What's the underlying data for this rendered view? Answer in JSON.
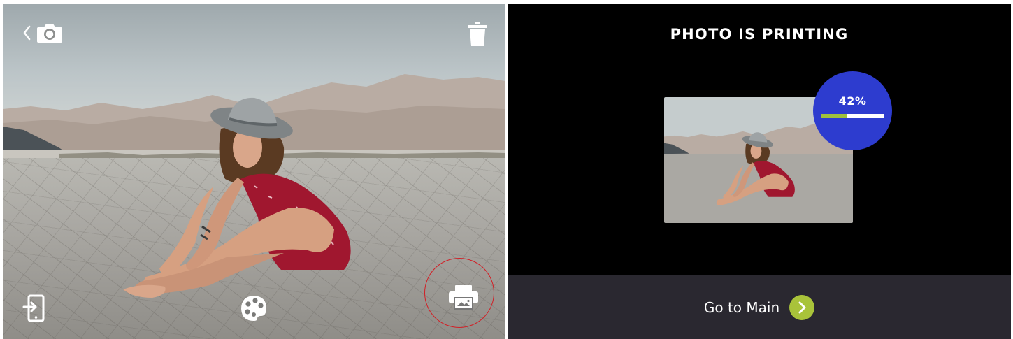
{
  "preview": {
    "icons": {
      "back": "chevron-left-icon",
      "camera": "camera-icon",
      "delete": "trash-icon",
      "share": "share-to-device-icon",
      "edit": "palette-icon",
      "print": "printer-icon"
    },
    "highlight_color": "#d21f26"
  },
  "printing": {
    "title": "PHOTO IS PRINTING",
    "progress_label": "42%",
    "progress_fraction": 0.42,
    "go_main_label": "Go to Main",
    "accent_blue": "#2d3ccf",
    "accent_green": "#9fc13b",
    "bar_color": "#2a2830"
  }
}
